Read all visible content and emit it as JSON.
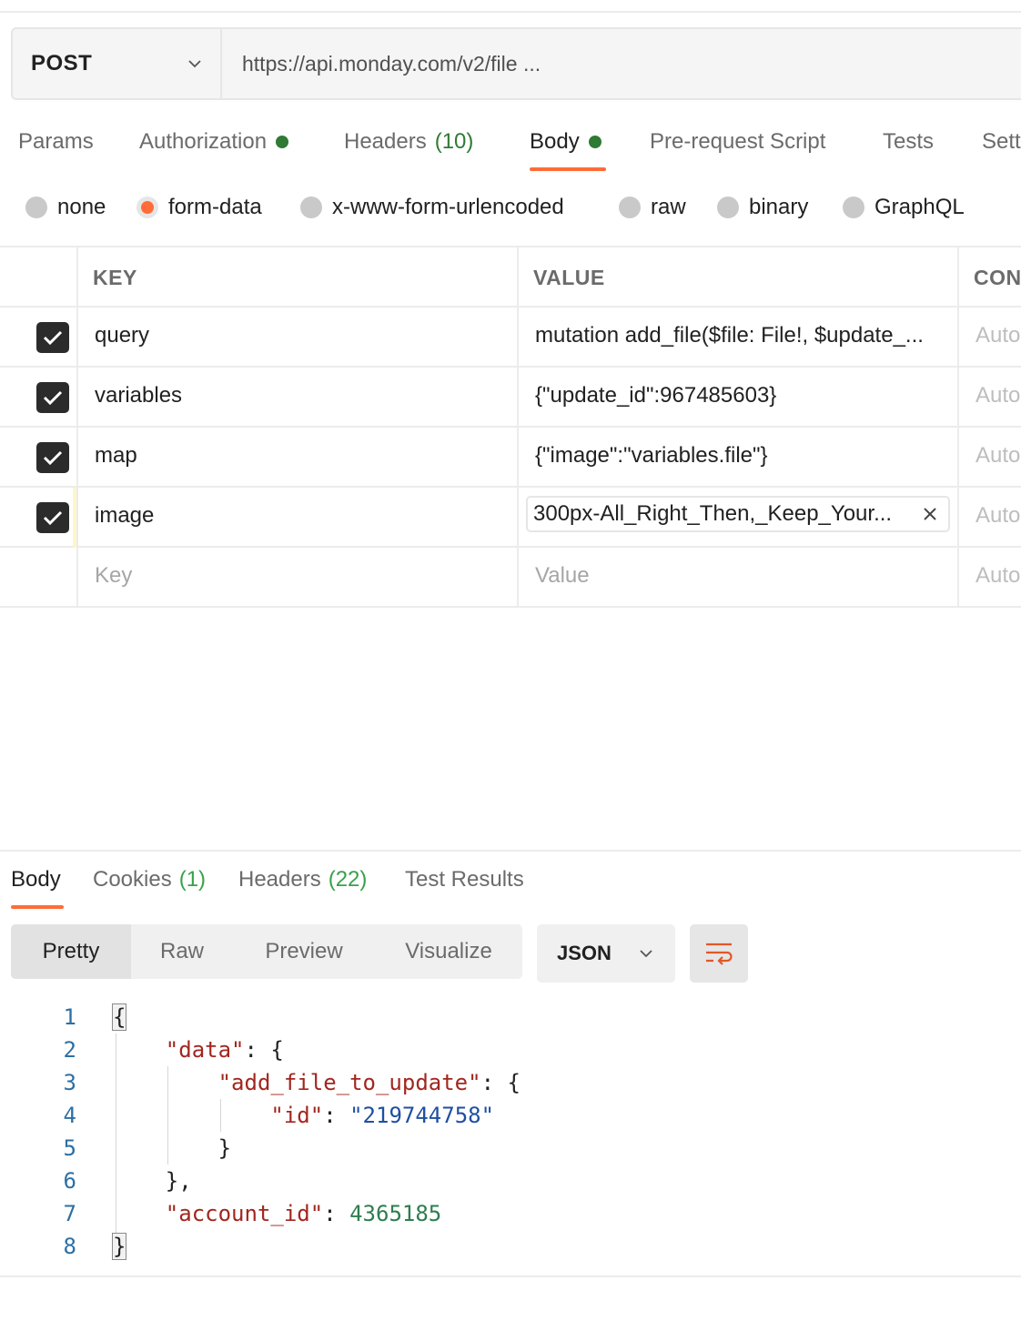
{
  "request": {
    "method": "POST",
    "url": "https://api.monday.com/v2/file ..."
  },
  "request_tabs": [
    {
      "label": "Params"
    },
    {
      "label": "Authorization",
      "indicator": "green-dot"
    },
    {
      "label": "Headers",
      "count": "(10)"
    },
    {
      "label": "Body",
      "indicator": "green-dot",
      "active": true
    },
    {
      "label": "Pre-request Script"
    },
    {
      "label": "Tests"
    },
    {
      "label": "Sett"
    }
  ],
  "body_types": [
    {
      "label": "none"
    },
    {
      "label": "form-data",
      "selected": true
    },
    {
      "label": "x-www-form-urlencoded"
    },
    {
      "label": "raw"
    },
    {
      "label": "binary"
    },
    {
      "label": "GraphQL"
    }
  ],
  "table": {
    "headers": {
      "key": "KEY",
      "value": "VALUE",
      "content_type": "CON"
    },
    "rows": [
      {
        "checked": true,
        "key": "query",
        "value": "mutation add_file($file: File!, $update_...",
        "content_type": "Auto"
      },
      {
        "checked": true,
        "key": "variables",
        "value": "{\"update_id\":967485603}",
        "content_type": "Auto"
      },
      {
        "checked": true,
        "key": "map",
        "value": "{\"image\":\"variables.file\"}",
        "content_type": "Auto"
      },
      {
        "checked": true,
        "key": "image",
        "value": "300px-All_Right_Then,_Keep_Your...",
        "content_type": "Auto",
        "is_file": true
      }
    ],
    "new_row": {
      "key_placeholder": "Key",
      "value_placeholder": "Value",
      "content_type": "Auto"
    }
  },
  "response_tabs": [
    {
      "label": "Body",
      "active": true
    },
    {
      "label": "Cookies",
      "count": "(1)"
    },
    {
      "label": "Headers",
      "count": "(22)"
    },
    {
      "label": "Test Results"
    }
  ],
  "view_modes": [
    "Pretty",
    "Raw",
    "Preview",
    "Visualize"
  ],
  "format": "JSON",
  "code": {
    "line_numbers": [
      "1",
      "2",
      "3",
      "4",
      "5",
      "6",
      "7",
      "8"
    ],
    "open_brace": "{",
    "data_key": "\"data\"",
    "add_file_key": "\"add_file_to_update\"",
    "id_key": "\"id\"",
    "id_value": "\"219744758\"",
    "account_key": "\"account_id\"",
    "account_value": "4365185",
    "close_brace": "}"
  },
  "colors": {
    "accent": "#ff6c37",
    "indicator_green": "#2f7a35",
    "count_green": "#39a14a",
    "json_key": "#a2261f",
    "json_string": "#1f4fa3",
    "json_number": "#2e7d4f"
  }
}
